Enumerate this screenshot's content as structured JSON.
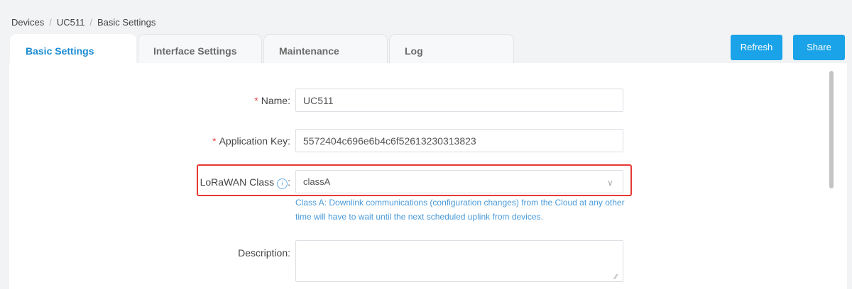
{
  "breadcrumb": {
    "items": [
      "Devices",
      "UC511",
      "Basic Settings"
    ],
    "separator": "/"
  },
  "tabs": [
    {
      "label": "Basic Settings",
      "active": true
    },
    {
      "label": "Interface Settings",
      "active": false
    },
    {
      "label": "Maintenance",
      "active": false
    },
    {
      "label": "Log",
      "active": false
    }
  ],
  "toolbar": {
    "refresh_label": "Refresh",
    "share_label": "Share"
  },
  "form": {
    "required_mark": "*",
    "name": {
      "label": "Name",
      "colon": ":",
      "value": "UC511"
    },
    "app_key": {
      "label": "Application Key",
      "colon": ":",
      "value": "5572404c696e6b4c6f52613230313823"
    },
    "lorawan_class": {
      "label": "LoRaWAN Class",
      "info_icon_glyph": "i",
      "colon": ":",
      "value": "classA",
      "arrow_glyph": "∨",
      "help": "Class A: Downlink communications (configuration changes) from the Cloud at any other time will have to wait until the next scheduled uplink from devices."
    },
    "description": {
      "label": "Description",
      "colon": ":",
      "value": "",
      "resize_glyph": "⁄⁄"
    }
  },
  "colors": {
    "accent": "#1a8bd3",
    "button": "#1aa3e8",
    "required": "#e5484d",
    "highlight": "#e53935",
    "help_text": "#4a9ad8"
  },
  "icons": {
    "info": "info-icon",
    "chevron": "chevron-down-icon"
  }
}
